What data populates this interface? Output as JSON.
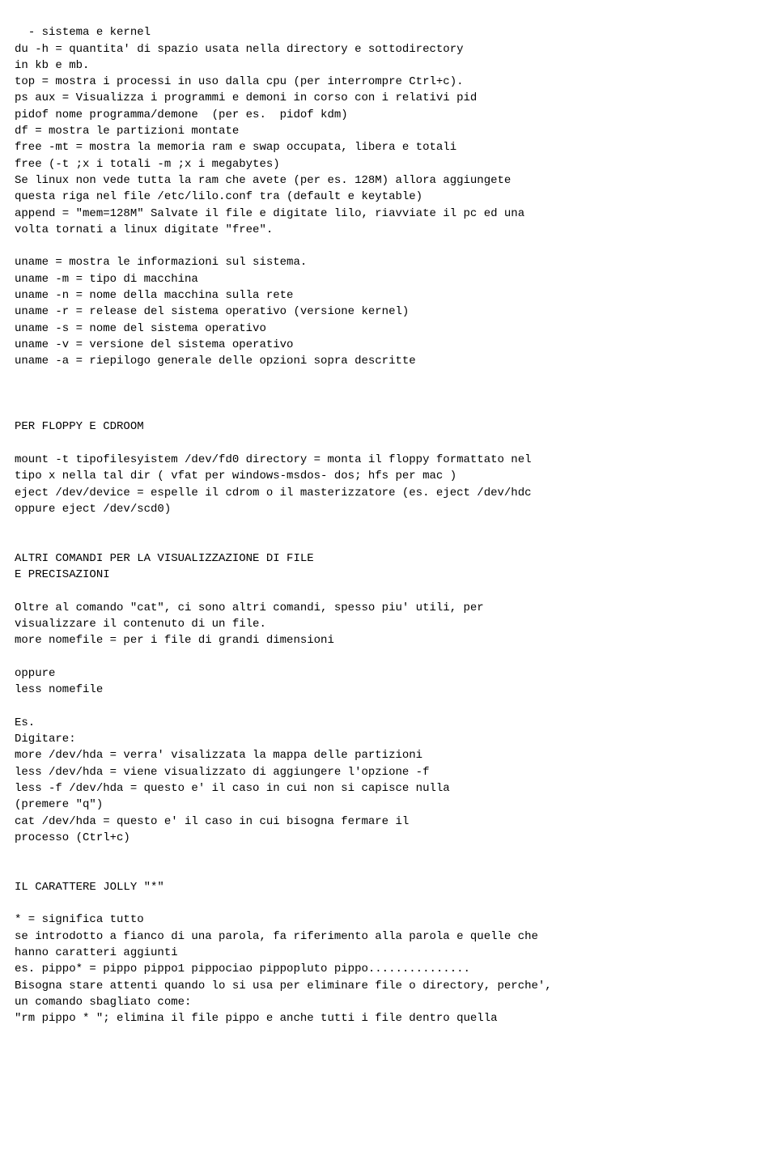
{
  "content": {
    "text": "- sistema e kernel\ndu -h = quantita' di spazio usata nella directory e sottodirectory\nin kb e mb.\ntop = mostra i processi in uso dalla cpu (per interrompre Ctrl+c).\nps aux = Visualizza i programmi e demoni in corso con i relativi pid\npidof nome programma/demone  (per es.  pidof kdm)\ndf = mostra le partizioni montate\nfree -mt = mostra la memoria ram e swap occupata, libera e totali\nfree (-t ;x i totali -m ;x i megabytes)\nSe linux non vede tutta la ram che avete (per es. 128M) allora aggiungete\nquesta riga nel file /etc/lilo.conf tra (default e keytable)\nappend = \"mem=128M\" Salvate il file e digitate lilo, riavviate il pc ed una\nvolta tornati a linux digitate \"free\".\n\nuname = mostra le informazioni sul sistema.\nuname -m = tipo di macchina\nuname -n = nome della macchina sulla rete\nuname -r = release del sistema operativo (versione kernel)\nuname -s = nome del sistema operativo\nuname -v = versione del sistema operativo\nuname -a = riepilogo generale delle opzioni sopra descritte\n\n\n\nPER FLOPPY E CDROOM\n\nmount -t tipofilesyistem /dev/fd0 directory = monta il floppy formattato nel\ntipo x nella tal dir ( vfat per windows-msdos- dos; hfs per mac )\neject /dev/device = espelle il cdrom o il masterizzatore (es. eject /dev/hdc\noppure eject /dev/scd0)\n\n\nALTRI COMANDI PER LA VISUALIZZAZIONE DI FILE\nE PRECISAZIONI\n\nOltre al comando \"cat\", ci sono altri comandi, spesso piu' utili, per\nvisualizzare il contenuto di un file.\nmore nomefile = per i file di grandi dimensioni\n\noppure\nless nomefile\n\nEs.\nDigitare:\nmore /dev/hda = verra' visalizzata la mappa delle partizioni\nless /dev/hda = viene visualizzato di aggiungere l'opzione -f\nless -f /dev/hda = questo e' il caso in cui non si capisce nulla\n(premere \"q\")\ncat /dev/hda = questo e' il caso in cui bisogna fermare il\nprocesso (Ctrl+c)\n\n\nIL CARATTERE JOLLY \"*\"\n\n* = significa tutto\nse introdotto a fianco di una parola, fa riferimento alla parola e quelle che\nhanno caratteri aggiunti\nes. pippo* = pippo pippo1 pippociao pippopluto pippo...............\nBisogna stare attenti quando lo si usa per eliminare file o directory, perche',\nun comando sbagliato come:\n\"rm pippo * \"; elimina il file pippo e anche tutti i file dentro quella"
  }
}
